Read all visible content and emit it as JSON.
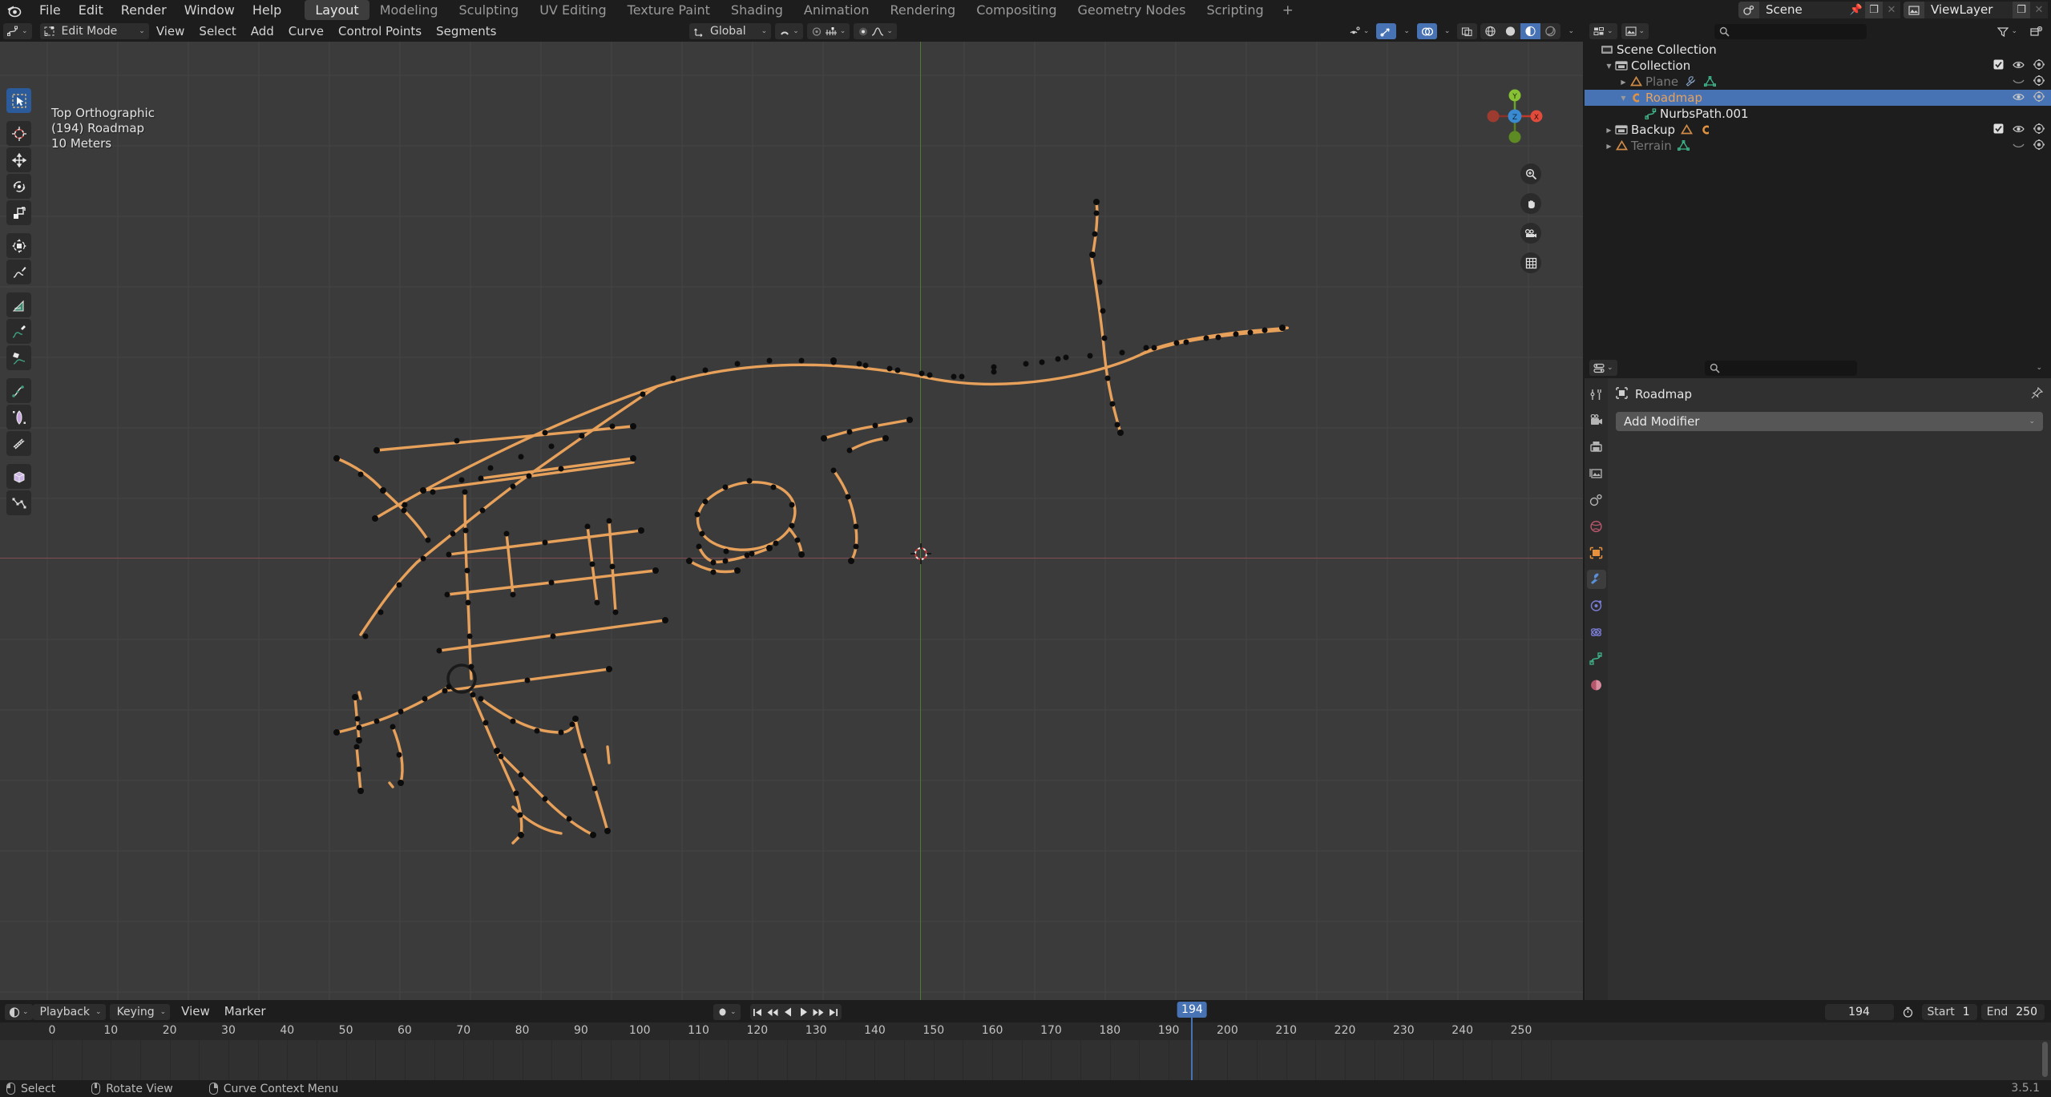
{
  "app": {
    "version": "3.5.1"
  },
  "topbar": {
    "logo_icon": "blender-logo-icon",
    "menus": [
      "File",
      "Edit",
      "Render",
      "Window",
      "Help"
    ],
    "workspaces": [
      {
        "label": "Layout",
        "active": true
      },
      {
        "label": "Modeling",
        "active": false
      },
      {
        "label": "Sculpting",
        "active": false
      },
      {
        "label": "UV Editing",
        "active": false
      },
      {
        "label": "Texture Paint",
        "active": false
      },
      {
        "label": "Shading",
        "active": false
      },
      {
        "label": "Animation",
        "active": false
      },
      {
        "label": "Rendering",
        "active": false
      },
      {
        "label": "Compositing",
        "active": false
      },
      {
        "label": "Geometry Nodes",
        "active": false
      },
      {
        "label": "Scripting",
        "active": false
      }
    ],
    "add_workspace_label": "+",
    "scene": {
      "icon": "scene-icon",
      "name": "Scene",
      "pin_icon": "pin-icon",
      "copy_icon": "duplicate-icon",
      "close_icon": "close-icon"
    },
    "viewlayer": {
      "icon": "viewlayer-icon",
      "name": "ViewLayer",
      "copy_icon": "duplicate-icon",
      "close_icon": "close-icon"
    }
  },
  "viewport": {
    "header": {
      "editor_type_icon": "editor-type-curve-icon",
      "mode_icon": "edit-mode-icon",
      "mode": "Edit Mode",
      "menus": [
        "View",
        "Select",
        "Add",
        "Curve",
        "Control Points",
        "Segments"
      ],
      "orientation_icon": "transform-orientation-icon",
      "orientation": "Global",
      "snap_icon": "snap-magnet-icon",
      "snap_to_icon": "snap-increment-icon",
      "proportional_icon": "proportional-editing-icon",
      "falloff_icon": "smooth-falloff-icon",
      "visibility_icon": "object-visibility-icon",
      "gizmo_icon": "gizmo-icon",
      "overlays_icon": "overlays-icon",
      "xray_icon": "xray-toggle-icon",
      "shading_modes": [
        "wireframe-shading-icon",
        "solid-shading-icon",
        "material-preview-icon",
        "rendered-shading-icon"
      ],
      "active_shading": "material-preview-icon"
    },
    "info_overlay": {
      "view": "Top Orthographic",
      "object": "(194) Roadmap",
      "grid_scale": "10 Meters"
    },
    "gizmo": {
      "x_label": "X",
      "y_label": "Y",
      "z_label": "Z"
    },
    "nav_buttons": [
      "zoom-icon",
      "pan-hand-icon",
      "camera-view-icon",
      "toggle-ortho-persp-icon"
    ],
    "toolbar": [
      {
        "name": "tweak-select-box-tool",
        "active": true
      },
      {
        "name": "cursor-tool",
        "active": false
      },
      {
        "name": "move-tool",
        "active": false
      },
      {
        "name": "rotate-tool",
        "active": false
      },
      {
        "name": "scale-tool",
        "active": false
      },
      {
        "name": "transform-tool",
        "active": false
      },
      {
        "name": "annotate-tool",
        "active": false
      },
      {
        "name": "measure-tool",
        "active": false
      },
      {
        "name": "draw-curve-tool",
        "active": false
      },
      {
        "name": "extrude-curve-tool",
        "active": false
      },
      {
        "name": "radius-tool",
        "active": false
      },
      {
        "name": "tilt-tool",
        "active": false
      },
      {
        "name": "shear-tool",
        "active": false
      },
      {
        "name": "to-sphere-tool",
        "active": false
      },
      {
        "name": "randomize-tool",
        "active": false
      }
    ],
    "cursor_3d_icon": "3d-cursor-icon",
    "colors": {
      "curve_selected": "#e8a15a",
      "control_point": "#0d0d0d",
      "background": "#3b3b3b",
      "grid": "#4a4a4a",
      "axis_x": "#824e53",
      "axis_y": "#4f7a36"
    }
  },
  "outliner": {
    "display_mode_icon": "outliner-display-mode-icon",
    "filter_scope_icon": "view-layer-icon",
    "search_placeholder": "",
    "search_icon": "search-icon",
    "filter_icon": "filter-icon",
    "new_collection_icon": "new-collection-icon",
    "rows": [
      {
        "indent": 0,
        "disclosure": "",
        "icon": "scene-collection-icon",
        "label": "Scene Collection",
        "selected": false,
        "dim": false,
        "checkbox": false,
        "eye": false,
        "camera": false
      },
      {
        "indent": 1,
        "disclosure": "▼",
        "icon": "collection-icon",
        "label": "Collection",
        "selected": false,
        "dim": false,
        "checkbox": true,
        "eye": true,
        "camera": true
      },
      {
        "indent": 2,
        "disclosure": "▶",
        "icon": "mesh-object-icon",
        "label": "Plane",
        "selected": false,
        "dim": true,
        "checkbox": false,
        "eye": "closed",
        "camera": true,
        "extra_icons": [
          "modifier-icon",
          "mesh-data-icon"
        ]
      },
      {
        "indent": 2,
        "disclosure": "▼",
        "icon": "curve-object-icon",
        "label": "Roadmap",
        "selected": true,
        "dim": false,
        "checkbox": false,
        "eye": true,
        "camera": true
      },
      {
        "indent": 3,
        "disclosure": "",
        "icon": "curve-data-icon",
        "label": "NurbsPath.001",
        "selected": false,
        "dim": false,
        "checkbox": false,
        "eye": false,
        "camera": false
      },
      {
        "indent": 1,
        "disclosure": "▶",
        "icon": "collection-icon",
        "label": "Backup",
        "selected": false,
        "dim": false,
        "checkbox": true,
        "eye": true,
        "camera": true,
        "extra_icons": [
          "mesh-object-icon",
          "curve-object-icon"
        ]
      },
      {
        "indent": 1,
        "disclosure": "▶",
        "icon": "mesh-object-icon",
        "label": "Terrain",
        "selected": false,
        "dim": true,
        "checkbox": false,
        "eye": "closed",
        "camera": true,
        "extra_icons": [
          "mesh-data-icon"
        ]
      }
    ]
  },
  "properties": {
    "editor_icon": "properties-editor-icon",
    "search_placeholder": "",
    "search_icon": "search-icon",
    "options_icon": "chevron-down-icon",
    "tabs": [
      {
        "name": "tool-tab",
        "active": false
      },
      {
        "name": "render-tab",
        "active": false
      },
      {
        "name": "output-tab",
        "active": false
      },
      {
        "name": "view-layer-tab",
        "active": false
      },
      {
        "name": "scene-tab",
        "active": false
      },
      {
        "name": "world-tab",
        "active": false
      },
      {
        "name": "object-tab",
        "active": false
      },
      {
        "name": "modifier-tab",
        "active": true
      },
      {
        "name": "particles-tab",
        "active": false
      },
      {
        "name": "physics-tab",
        "active": false
      },
      {
        "name": "object-data-tab",
        "active": false
      },
      {
        "name": "material-tab",
        "active": false
      }
    ],
    "breadcrumb_icon": "object-icon",
    "breadcrumb": "Roadmap",
    "pin_icon": "pin-icon",
    "add_modifier_label": "Add Modifier",
    "add_modifier_chevron": "chevron-down-icon"
  },
  "timeline": {
    "editor_icon": "timeline-editor-icon",
    "menus": [
      {
        "label": "Playback",
        "has_chevron": true
      },
      {
        "label": "Keying",
        "has_chevron": true
      },
      {
        "label": "View",
        "has_chevron": false
      },
      {
        "label": "Marker",
        "has_chevron": false
      }
    ],
    "keying_set_icon": "keying-set-icon",
    "transport": [
      "jump-to-start-icon",
      "jump-prev-keyframe-icon",
      "play-reverse-icon",
      "play-icon",
      "jump-next-keyframe-icon",
      "jump-to-end-icon"
    ],
    "current_frame": "194",
    "autokey_icon": "auto-keying-icon",
    "start_label": "Start",
    "start_value": "1",
    "end_label": "End",
    "end_value": "250",
    "ruler_ticks": [
      0,
      10,
      20,
      30,
      40,
      50,
      60,
      70,
      80,
      90,
      100,
      110,
      120,
      130,
      140,
      150,
      160,
      170,
      180,
      190,
      200,
      210,
      220,
      230,
      240,
      250
    ],
    "playhead_label": "194",
    "playhead_color": "#4772b3"
  },
  "status_bar": {
    "items": [
      {
        "icon": "mouse-left-icon",
        "label": "Select"
      },
      {
        "icon": "mouse-middle-icon",
        "label": "Rotate View"
      },
      {
        "icon": "mouse-right-icon",
        "label": "Curve Context Menu"
      }
    ],
    "version": "3.5.1"
  }
}
